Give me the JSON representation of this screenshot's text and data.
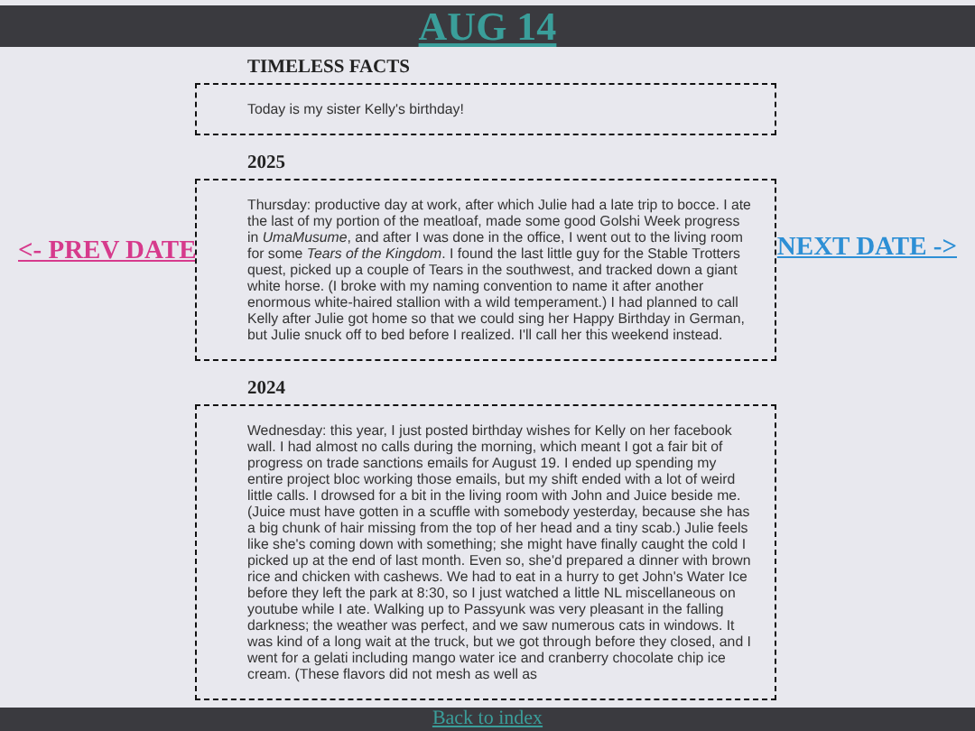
{
  "title": "AUG 14",
  "prev_link": "<- PREV DATE",
  "next_link": "NEXT DATE ->",
  "sections": [
    {
      "heading": "TIMELESS FACTS",
      "text": "Today is my sister Kelly's birthday!"
    },
    {
      "heading": "2025",
      "text": "Thursday: productive day at work, after which Julie had a late trip to bocce. I ate the last of my portion of the meatloaf, made some good Golshi Week progress in *UmaMusume*, and after I was done in the office, I went out to the living room for some *Tears of the Kingdom*. I found the last little guy for the Stable Trotters quest, picked up a couple of Tears in the southwest, and tracked down a giant white horse. (I broke with my naming convention to name it after another enormous white-haired stallion with a wild temperament.) I had planned to call Kelly after Julie got home so that we could sing her Happy Birthday in German, but Julie snuck off to bed before I realized. I'll call her this weekend instead."
    },
    {
      "heading": "2024",
      "text": "Wednesday: this year, I just posted birthday wishes for Kelly on her facebook wall. I had almost no calls during the morning, which meant I got a fair bit of progress on trade sanctions emails for August 19. I ended up spending my entire project bloc working those emails, but my shift ended with a lot of weird little calls. I drowsed for a bit in the living room with John and Juice beside me. (Juice must have gotten in a scuffle with somebody yesterday, because she has a big chunk of hair missing from the top of her head and a tiny scab.) Julie feels like she's coming down with something; she might have finally caught the cold I picked up at the end of last month. Even so, she'd prepared a dinner with brown rice and chicken with cashews. We had to eat in a hurry to get John's Water Ice before they left the park at 8:30, so I just watched a little NL miscellaneous on youtube while I ate. Walking up to Passyunk was very pleasant in the falling darkness; the weather was perfect, and we saw numerous cats in windows. It was kind of a long wait at the truck, but we got through before they closed, and I went for a gelati including mango water ice and cranberry chocolate chip ice cream. (These flavors did not mesh as well as"
    }
  ],
  "footer_link": "Back to index"
}
